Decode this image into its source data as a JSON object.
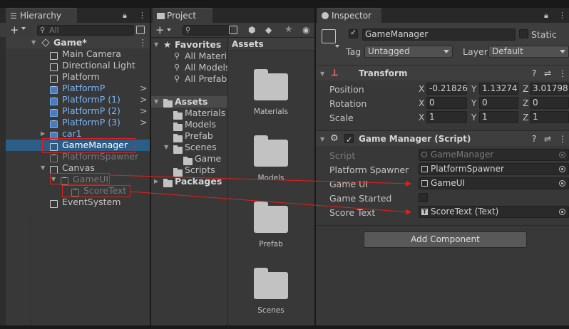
{
  "hierarchy": {
    "tab_label": "Hierarchy",
    "search_placeholder": "All",
    "scene_name": "Game*",
    "items": [
      {
        "label": "Main Camera",
        "style": "normal",
        "arrow": ""
      },
      {
        "label": "Directional Light",
        "style": "normal",
        "arrow": ""
      },
      {
        "label": "Platform",
        "style": "normal",
        "arrow": ""
      },
      {
        "label": "PlatformP",
        "style": "prefab",
        "arrow": ">"
      },
      {
        "label": "PlatformP (1)",
        "style": "prefab",
        "arrow": ">"
      },
      {
        "label": "PlatformP (2)",
        "style": "prefab",
        "arrow": ">"
      },
      {
        "label": "PlatformP (3)",
        "style": "prefab",
        "arrow": ">"
      },
      {
        "label": "car1",
        "style": "prefab",
        "arrow": ""
      },
      {
        "label": "GameManager",
        "style": "selected",
        "arrow": ""
      },
      {
        "label": "PlatformSpawner",
        "style": "disabled",
        "arrow": ""
      },
      {
        "label": "Canvas",
        "style": "normal",
        "arrow": ""
      },
      {
        "label": "GameUI",
        "style": "disabled",
        "arrow": ""
      },
      {
        "label": "ScoreText",
        "style": "disabled",
        "arrow": ""
      },
      {
        "label": "EventSystem",
        "style": "normal",
        "arrow": ""
      }
    ]
  },
  "project": {
    "tab_label": "Project",
    "tree": {
      "favorites": "Favorites",
      "fav_items": [
        "All Materia",
        "All Models",
        "All Prefabs"
      ],
      "assets": "Assets",
      "asset_folders": [
        "Materials",
        "Models",
        "Prefab",
        "Scenes",
        "Game",
        "Scripts"
      ],
      "packages": "Packages"
    },
    "grid_header": "Assets",
    "grid_folders": [
      "Materials",
      "Models",
      "Prefab",
      "Scenes"
    ]
  },
  "inspector": {
    "tab_label": "Inspector",
    "object_name": "GameManager",
    "static_label": "Static",
    "tag_label": "Tag",
    "tag_value": "Untagged",
    "layer_label": "Layer",
    "layer_value": "Default",
    "transform": {
      "title": "Transform",
      "position_label": "Position",
      "rotation_label": "Rotation",
      "scale_label": "Scale",
      "position": {
        "x": "-0.21826",
        "y": "1.13274",
        "z": "3.01798"
      },
      "rotation": {
        "x": "0",
        "y": "0",
        "z": "0"
      },
      "scale": {
        "x": "1",
        "y": "1",
        "z": "1"
      }
    },
    "script_component": {
      "title": "Game Manager (Script)",
      "script_label": "Script",
      "script_value": "GameManager",
      "spawner_label": "Platform Spawner",
      "spawner_value": "PlatformSpawner",
      "gameui_label": "Game UI",
      "gameui_value": "GameUI",
      "started_label": "Game Started",
      "score_label": "Score Text",
      "score_value": "ScoreText (Text)"
    },
    "add_component": "Add Component"
  },
  "colors": {
    "selection": "#2c5d87",
    "annotation_red": "#e0221b",
    "prefab_blue": "#7ab4f5"
  }
}
